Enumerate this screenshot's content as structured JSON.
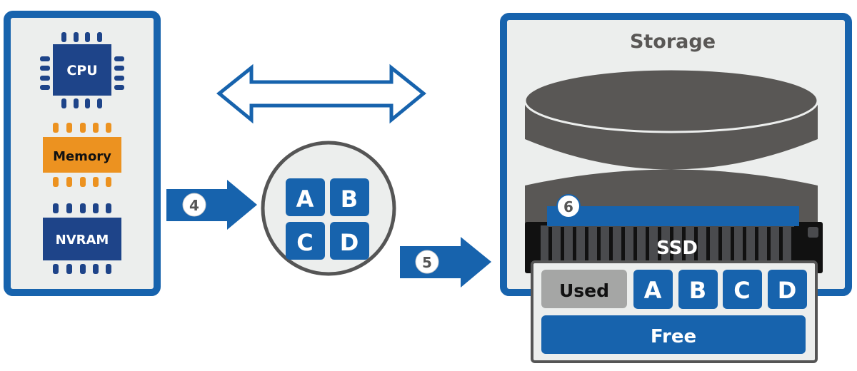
{
  "colors": {
    "blue": "#1763ad",
    "navy": "#1e4489",
    "orange": "#ec9220",
    "panel": "#eceeed",
    "gray": "#595755",
    "used": "#a5a6a5"
  },
  "compute": {
    "cpu": "CPU",
    "memory": "Memory",
    "nvram": "NVRAM"
  },
  "steps": {
    "four": "4",
    "five": "5",
    "six": "6"
  },
  "blocks": [
    "A",
    "B",
    "C",
    "D"
  ],
  "storage": {
    "title": "Storage",
    "ssd": "SSD",
    "used": "Used",
    "free": "Free",
    "blocks": [
      "A",
      "B",
      "C",
      "D"
    ]
  }
}
